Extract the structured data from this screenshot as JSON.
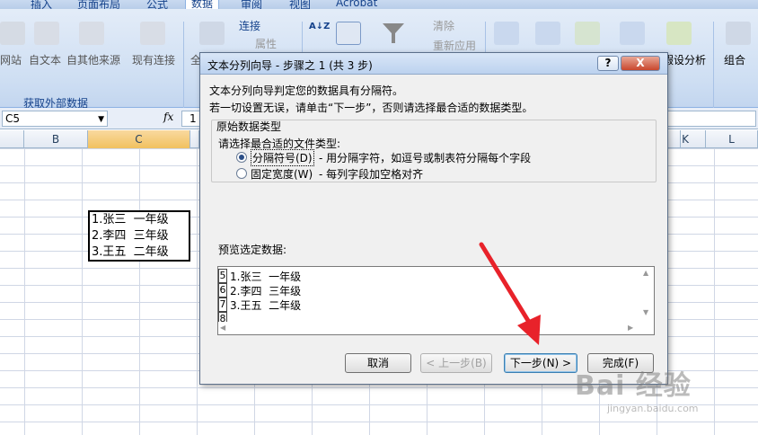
{
  "ribbon": {
    "tabs": [
      "插入",
      "页面布局",
      "公式",
      "数据",
      "审阅",
      "视图",
      "Acrobat"
    ],
    "active_tab": "数据",
    "groups": {
      "external_data": {
        "caption": "获取外部数据",
        "items": [
          "网站",
          "自文本",
          "自其他来源",
          "现有连接"
        ]
      },
      "connections": {
        "items": [
          "全",
          "连接",
          "属性"
        ]
      },
      "sort_filter": {
        "items": [
          "清除",
          "重新应用"
        ]
      },
      "data_tools": {
        "items": [
          "假设分析"
        ]
      },
      "outline": {
        "items": [
          "组合"
        ]
      }
    }
  },
  "formula_bar": {
    "name_box": "C5",
    "fx_label": "fx",
    "content": "1"
  },
  "columns": [
    "B",
    "C",
    "K",
    "L"
  ],
  "selected_column": "C",
  "cells": [
    "1.张三  一年级",
    "2.李四  三年级",
    "3.王五  二年级"
  ],
  "dialog": {
    "title": "文本分列向导 - 步骤之 1 (共 3 步)",
    "help_btn": "?",
    "close_btn": "X",
    "line1": "文本分列向导判定您的数据具有分隔符。",
    "line2": "若一切设置无误，请单击“下一步”，否则请选择最合适的数据类型。",
    "group_title": "原始数据类型",
    "prompt": "请选择最合适的文件类型:",
    "option1_label": "分隔符号(D)",
    "option1_desc": "- 用分隔字符，如逗号或制表符分隔每个字段",
    "option2_label": "固定宽度(W)",
    "option2_desc": "- 每列字段加空格对齐",
    "selected_option": "分隔符号(D)",
    "preview_label": "预览选定数据:",
    "preview_rows": [
      {
        "num": "5",
        "text": "1.张三  一年级"
      },
      {
        "num": "6",
        "text": "2.李四  三年级"
      },
      {
        "num": "7",
        "text": "3.王五  二年级"
      },
      {
        "num": "8",
        "text": ""
      }
    ],
    "buttons": {
      "cancel": "取消",
      "back": "< 上一步(B)",
      "next": "下一步(N) >",
      "finish": "完成(F)"
    }
  },
  "watermark": {
    "logo": "Bai 经验",
    "url": "jingyan.baidu.com"
  },
  "colors": {
    "ribbon_text": "#15428b",
    "annotation_arrow": "#e8222a",
    "selected_column": "#f1c15f"
  }
}
